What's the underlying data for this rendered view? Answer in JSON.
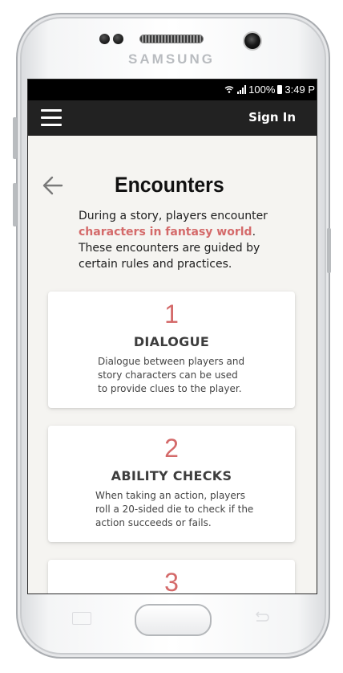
{
  "device": {
    "brand": "SAMSUNG"
  },
  "status_bar": {
    "battery": "100%",
    "time": "3:49 P"
  },
  "app_bar": {
    "menu_icon": "hamburger-menu-icon",
    "sign_in_label": "Sign In"
  },
  "page": {
    "back_icon": "arrow-left-icon",
    "title": "Encounters",
    "intro_before": "During a story, players encounter ",
    "intro_highlight": "characters in fantasy world",
    "intro_after": ". These encounters are guided by certain rules and practices.",
    "highlight_color": "#d46a6a"
  },
  "cards": [
    {
      "number": "1",
      "title": "DIALOGUE",
      "text": "Dialogue between players and story characters can be used to provide clues to the player."
    },
    {
      "number": "2",
      "title": "ABILITY CHECKS",
      "text": "When taking an action, players roll a 20-sided die to check if the action succeeds or fails."
    },
    {
      "number": "3",
      "title": "",
      "text": ""
    }
  ],
  "colors": {
    "app_bar": "#222222",
    "accent": "#d46a6a",
    "background": "#f5f4f1"
  }
}
